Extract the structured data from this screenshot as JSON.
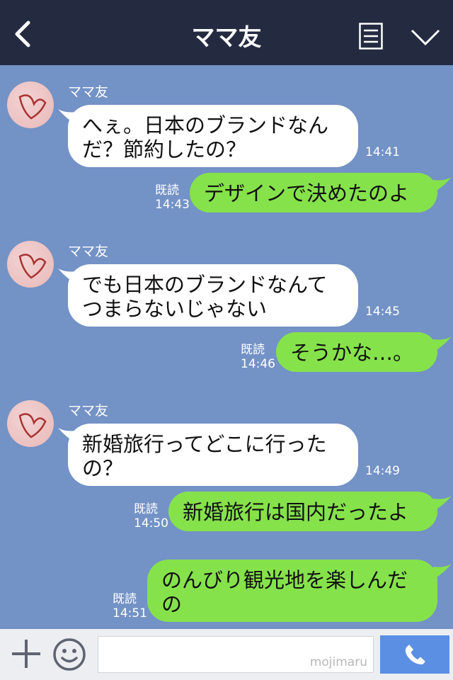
{
  "header": {
    "title": "ママ友"
  },
  "messages": [
    {
      "type": "incoming",
      "sender": "ママ友",
      "lines": [
        "へぇ。日本のブランドなん",
        "だ？節約したの？"
      ],
      "time": "14:41"
    },
    {
      "type": "outgoing",
      "read": "既読",
      "lines": [
        "デザインで決めたのよ"
      ],
      "time": "14:43"
    },
    {
      "type": "incoming",
      "sender": "ママ友",
      "lines": [
        "でも日本のブランドなんて",
        "つまらないじゃない"
      ],
      "time": "14:45"
    },
    {
      "type": "outgoing",
      "read": "既読",
      "lines": [
        "そうかな…。"
      ],
      "time": "14:46"
    },
    {
      "type": "incoming",
      "sender": "ママ友",
      "lines": [
        "新婚旅行ってどこに行った",
        "の？"
      ],
      "time": "14:49"
    },
    {
      "type": "outgoing",
      "read": "既読",
      "lines": [
        "新婚旅行は国内だったよ"
      ],
      "time": "14:50"
    },
    {
      "type": "outgoing",
      "read": "既読",
      "lines": [
        "のんびり観光地を楽しんだ",
        "の"
      ],
      "time": "14:51"
    }
  ],
  "input": {
    "watermark": "mojimaru"
  },
  "icons": {
    "back": "chevron-left-icon",
    "menu": "menu-list-icon",
    "collapse": "chevron-down-icon",
    "add": "plus-icon",
    "emoji": "smiley-icon",
    "send": "phone-icon"
  },
  "colors": {
    "header": "#242b41",
    "chat_bg": "#7392c6",
    "outgoing_bubble": "#86e24b",
    "incoming_bubble": "#ffffff",
    "send_button": "#5b8fe4"
  }
}
